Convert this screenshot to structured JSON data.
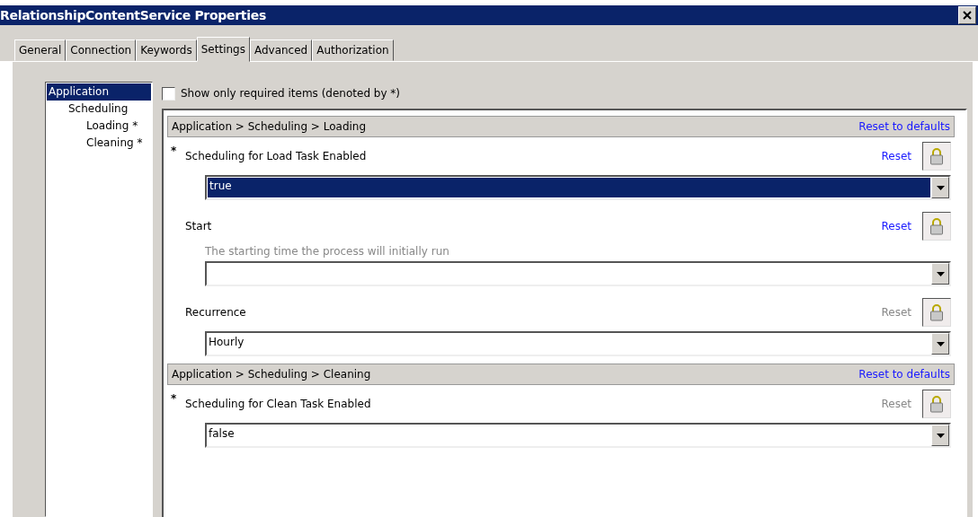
{
  "window": {
    "title": "RelationshipContentService Properties"
  },
  "tabs": [
    {
      "label": "General",
      "selected": false
    },
    {
      "label": "Connection",
      "selected": false
    },
    {
      "label": "Keywords",
      "selected": false
    },
    {
      "label": "Settings",
      "selected": true
    },
    {
      "label": "Advanced",
      "selected": false
    },
    {
      "label": "Authorization",
      "selected": false
    }
  ],
  "tree": [
    {
      "label": "Application",
      "selected": true,
      "children": [
        {
          "label": "Scheduling",
          "selected": false,
          "children": [
            {
              "label": "Loading *",
              "selected": false
            },
            {
              "label": "Cleaning *",
              "selected": false
            }
          ]
        }
      ]
    }
  ],
  "required_filter": {
    "label": "Show only required items (denoted by *)",
    "checked": false
  },
  "sections": [
    {
      "path": "Application > Scheduling > Loading",
      "reset_all": "Reset to defaults",
      "settings": [
        {
          "required_mark": "*",
          "label": "Scheduling for Load Task Enabled",
          "reset": {
            "label": "Reset",
            "disabled": false
          },
          "value": "true",
          "selected": true
        },
        {
          "label": "Start",
          "reset": {
            "label": "Reset",
            "disabled": false
          },
          "description": "The starting time the process will initially run",
          "selected": false
        },
        {
          "label": "Recurrence",
          "reset": {
            "label": "Reset",
            "disabled": true
          },
          "value": "Hourly",
          "selected": false
        }
      ]
    },
    {
      "path": "Application > Scheduling > Cleaning",
      "reset_all": "Reset to defaults",
      "settings": [
        {
          "required_mark": "*",
          "label": "Scheduling for Clean Task Enabled",
          "reset": {
            "label": "Reset",
            "disabled": true
          },
          "value": "false",
          "selected": false
        }
      ]
    }
  ]
}
